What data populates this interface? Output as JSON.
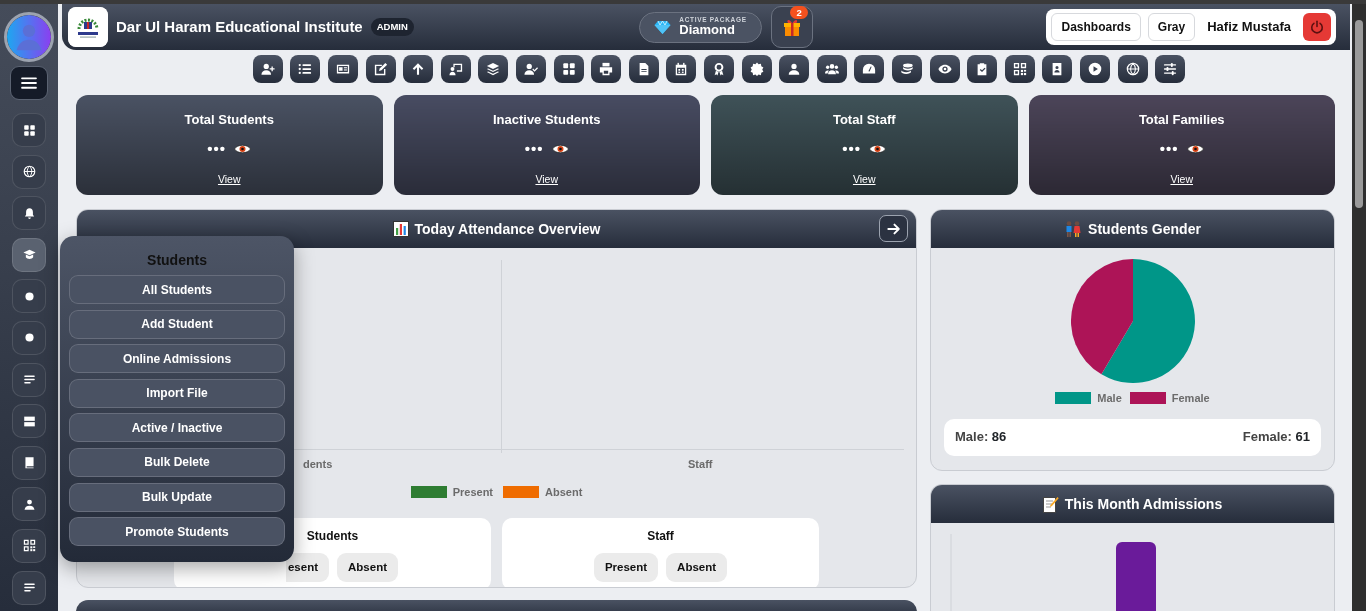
{
  "sidebar": {
    "items": [
      {
        "selected": false
      },
      {
        "selected": false
      },
      {
        "selected": false
      },
      {
        "selected": true
      },
      {
        "selected": false
      },
      {
        "selected": false
      },
      {
        "selected": false
      },
      {
        "selected": false
      },
      {
        "selected": false
      },
      {
        "selected": false
      },
      {
        "selected": false
      },
      {
        "selected": false
      }
    ]
  },
  "header": {
    "title": "Dar Ul Haram Educational Institute",
    "role_badge": "ADMIN",
    "package": {
      "label": "ACTIVE PACKAGE",
      "name": "Diamond"
    },
    "gift_badge": "2",
    "buttons": [
      "Dashboards",
      "Gray"
    ],
    "user_name": "Hafiz Mustafa"
  },
  "stats": [
    {
      "title": "Total Students",
      "value": "•••",
      "link": "View",
      "color": "#4a5263"
    },
    {
      "title": "Inactive Students",
      "value": "•••",
      "link": "View",
      "color": "#484c62"
    },
    {
      "title": "Total Staff",
      "value": "•••",
      "link": "View",
      "color": "#3f5258"
    },
    {
      "title": "Total Families",
      "value": "•••",
      "link": "View",
      "color": "#4c4559"
    }
  ],
  "attendance": {
    "title": "Today Attendance Overview",
    "axis_labels": [
      "dents",
      "Staff"
    ],
    "legend": [
      {
        "label": "Present",
        "color": "#2e7d32"
      },
      {
        "label": "Absent",
        "color": "#ef6c00"
      }
    ],
    "groups": [
      {
        "title": "Students",
        "buttons": [
          "esent",
          "Absent"
        ]
      },
      {
        "title": "Staff",
        "buttons": [
          "Present",
          "Absent"
        ]
      }
    ]
  },
  "gender": {
    "title": "Students Gender",
    "chart_data": {
      "type": "pie",
      "categories": [
        "Male",
        "Female"
      ],
      "values": [
        58.5,
        41.5
      ],
      "legend": "bottom"
    },
    "slices": [
      {
        "color": "#009688"
      },
      {
        "color": "#ad1457"
      }
    ],
    "summary": [
      {
        "label": "Male:",
        "value": "86"
      },
      {
        "label": "Female:",
        "value": "61"
      }
    ]
  },
  "admissions": {
    "title": "This Month Admissions"
  },
  "students_menu": {
    "title": "Students",
    "items": [
      "All Students",
      "Add Student",
      "Online Admissions",
      "Import File",
      "Active / Inactive",
      "Bulk Delete",
      "Bulk Update",
      "Promote Students"
    ]
  }
}
